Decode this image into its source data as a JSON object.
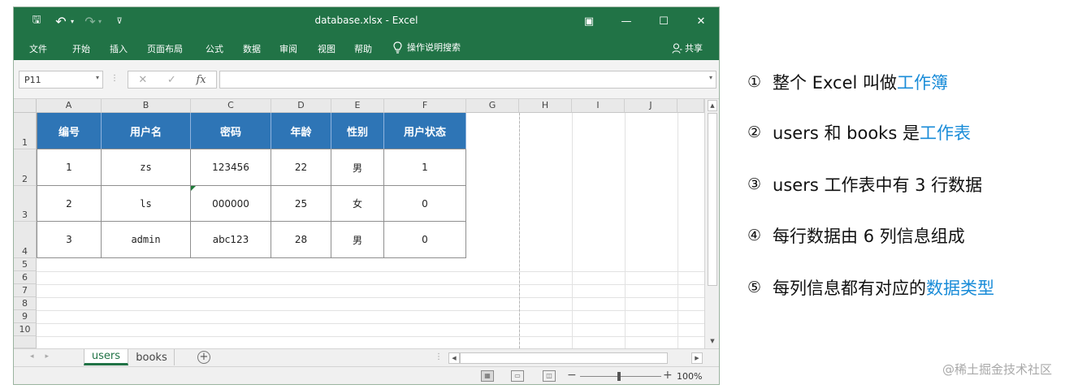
{
  "window": {
    "title": "database.xlsx  -  Excel",
    "qa_save": "🖫",
    "qa_undo": "↶",
    "qa_redo": "↷",
    "qa_more": "⊽",
    "restore": "▣",
    "minimize": "—",
    "maximize": "☐",
    "close": "✕"
  },
  "ribbon": {
    "tabs": [
      "文件",
      "开始",
      "插入",
      "页面布局",
      "公式",
      "数据",
      "审阅",
      "视图",
      "帮助"
    ],
    "tell_me": "操作说明搜索",
    "share": "共享"
  },
  "formula_bar": {
    "name_box": "P11",
    "cancel": "✕",
    "enter": "✓",
    "fx": "fx",
    "value": ""
  },
  "columns": [
    "A",
    "B",
    "C",
    "D",
    "E",
    "F",
    "G",
    "H",
    "I",
    "J"
  ],
  "rows": [
    "1",
    "2",
    "3",
    "4",
    "5",
    "6",
    "7",
    "8",
    "9",
    "10"
  ],
  "table": {
    "headers": [
      "编号",
      "用户名",
      "密码",
      "年龄",
      "性别",
      "用户状态"
    ],
    "rows": [
      [
        "1",
        "zs",
        "123456",
        "22",
        "男",
        "1"
      ],
      [
        "2",
        "ls",
        "000000",
        "25",
        "女",
        "0"
      ],
      [
        "3",
        "admin",
        "abc123",
        "28",
        "男",
        "0"
      ]
    ]
  },
  "sheets": {
    "active": "users",
    "other": "books",
    "add": "+"
  },
  "status": {
    "zoom": "100%"
  },
  "notes": [
    {
      "num": "①",
      "pre": "整个 Excel 叫做",
      "hl": "工作簿"
    },
    {
      "num": "②",
      "pre": "users 和 books 是",
      "hl": "工作表"
    },
    {
      "num": "③",
      "pre": "users 工作表中有 3 行数据",
      "hl": ""
    },
    {
      "num": "④",
      "pre": "每行数据由 6 列信息组成",
      "hl": ""
    },
    {
      "num": "⑤",
      "pre": "每列信息都有对应的",
      "hl": "数据类型"
    }
  ],
  "watermark": "@稀土掘金技术社区"
}
